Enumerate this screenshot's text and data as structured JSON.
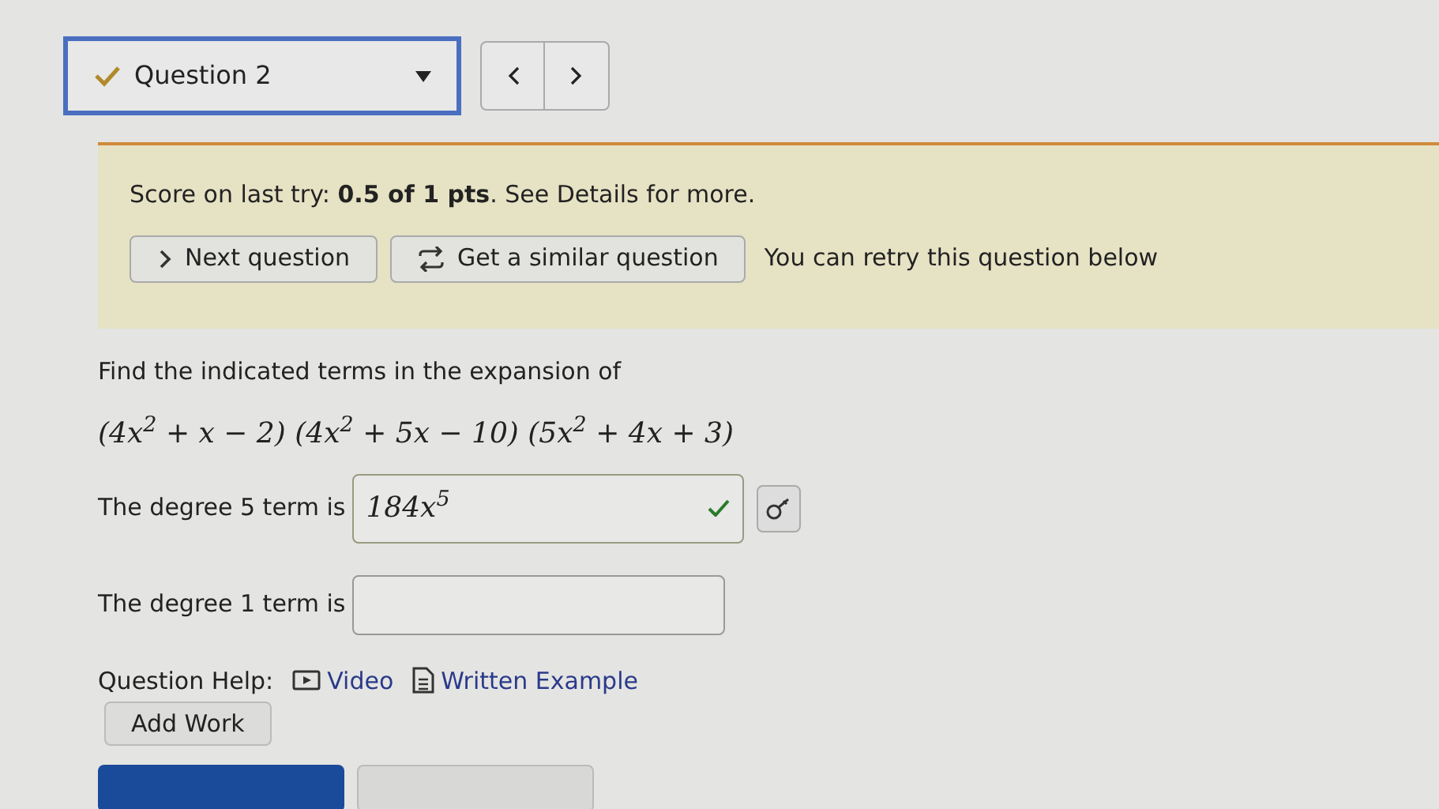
{
  "question_nav": {
    "label": "Question 2",
    "answered": true
  },
  "feedback": {
    "score_text": "Score on last try: **0.5 of 1 pts**. See Details for more.",
    "buttons": [
      {
        "kind": "next",
        "label": "Next question"
      },
      {
        "kind": "similar",
        "label": "Get a similar question"
      }
    ],
    "retry_note": "You can retry this question below"
  },
  "question": {
    "prompt": "Find the indicated terms in the expansion of",
    "expression": "(4x$^{2}$ + x − 2) (4x$^{2}$ + 5x − 10) (5x$^{2}$ + 4x + 3)",
    "answers": [
      {
        "label": "The degree 5 term is",
        "value": "184x$^{5}$",
        "correct": true
      },
      {
        "label": "The degree 1 term is",
        "correct": false
      }
    ]
  },
  "help": {
    "label": "Question Help:",
    "links": [
      {
        "kind": "video",
        "label": "Video"
      },
      {
        "kind": "example",
        "label": "Written Example"
      }
    ]
  },
  "add_work": "Add Work"
}
